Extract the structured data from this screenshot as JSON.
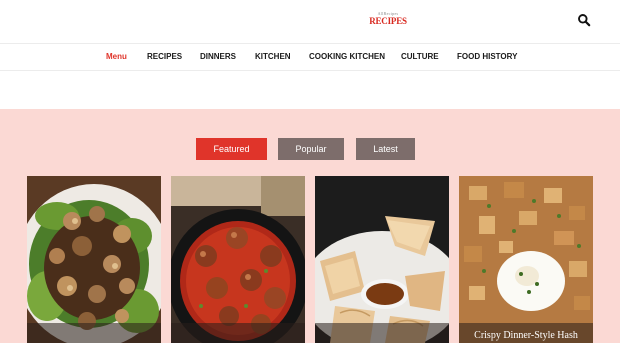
{
  "brand": {
    "logo_small": "AllRecipes",
    "logo_main": "RECIPES",
    "accent": "#e0342a"
  },
  "header": {
    "search_icon": "search-icon"
  },
  "nav": {
    "items": [
      {
        "label": "Menu",
        "active": true
      },
      {
        "label": "RECIPES"
      },
      {
        "label": "DINNERS"
      },
      {
        "label": "KITCHEN"
      },
      {
        "label": "COOKING KITCHEN"
      },
      {
        "label": "CULTURE"
      },
      {
        "label": "FOOD HISTORY"
      }
    ]
  },
  "tabs": {
    "featured": "Featured",
    "popular": "Popular",
    "latest": "Latest",
    "active_color": "#e0342a",
    "inactive_color": "#7d6d6b"
  },
  "cards": [
    {
      "title": "",
      "image": "mushroom-lentil-salad-photo"
    },
    {
      "title": "",
      "image": "meatballs-in-tomato-sauce-photo"
    },
    {
      "title": "",
      "image": "fried-dumplings-with-dip-photo"
    },
    {
      "title": "Crispy Dinner-Style Hash",
      "image": "crispy-hash-with-egg-photo"
    }
  ],
  "colors": {
    "section_bg": "#fbd9d4"
  }
}
